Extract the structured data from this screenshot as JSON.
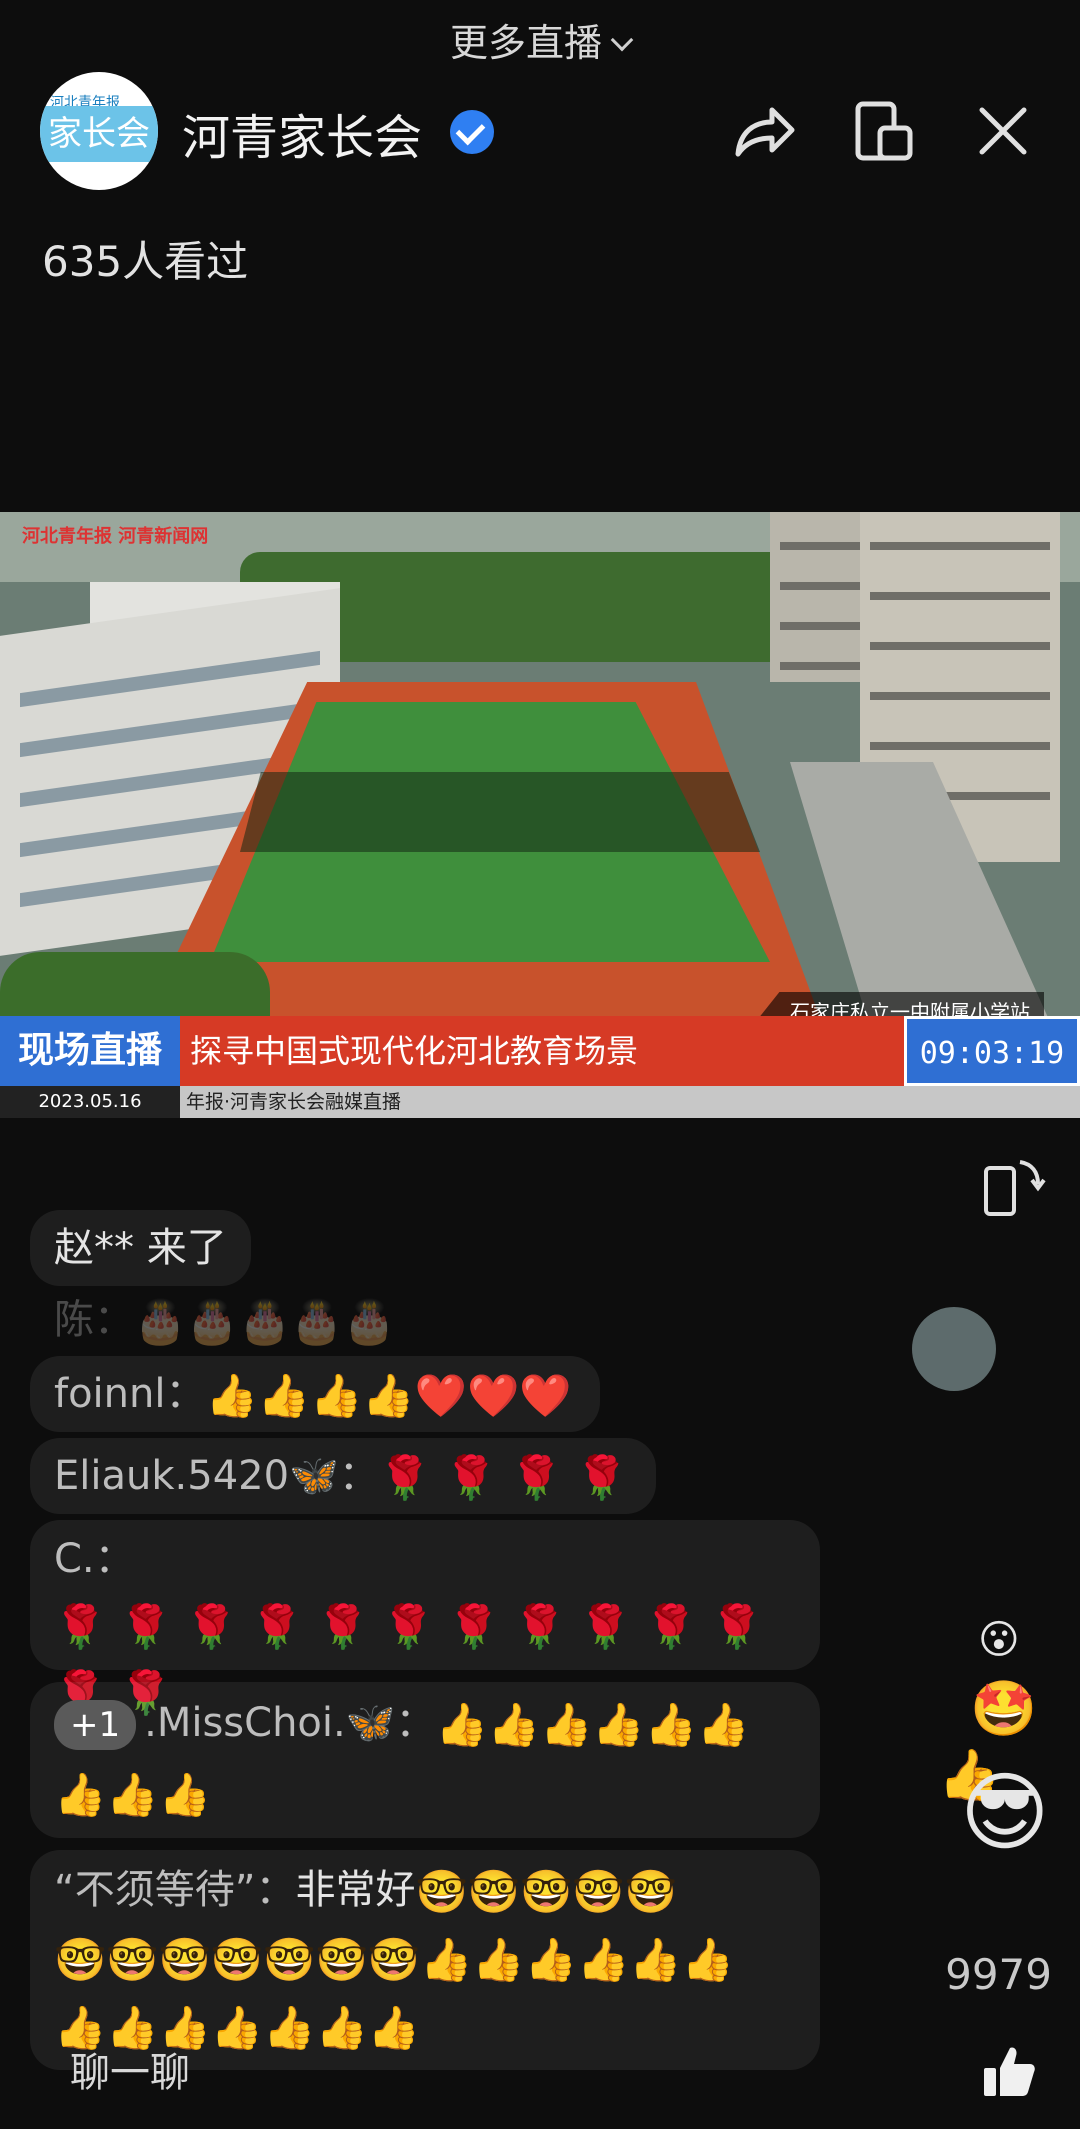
{
  "top": {
    "more_live": "更多直播"
  },
  "header": {
    "avatar_top": "河北青年报",
    "avatar_main": "家长会",
    "channel_name": "河青家长会",
    "viewers": "635人看过"
  },
  "video": {
    "watermark": "河北青年报 河青新闻网",
    "station": "石家庄私立一中附属小学站",
    "live_label": "现场直播",
    "headline": "探寻中国式现代化河北教育场景",
    "clock": "09:03:19",
    "date": "2023.05.16",
    "ticker": "年报·河青家长会融媒直播"
  },
  "comments": {
    "entered": "赵** 来了",
    "c1_name": "陈：",
    "c1_emoji": "🎂🎂🎂🎂🎂",
    "c2_name": "foinnl：",
    "c2_emoji": "👍👍👍👍❤️❤️❤️",
    "c3_name": "Eliauk.5420🦋：",
    "c3_emoji": "🌹 🌹 🌹 🌹",
    "c4_name": "C.：",
    "c4_emoji_line1": "🌹 🌹 🌹 🌹 🌹 🌹 🌹 🌹 🌹 🌹 🌹",
    "c4_emoji_line2": "🌹 🌹",
    "c5_badge": "+1",
    "c5_name": ".MissChoi.🦋：",
    "c5_emoji_line1": "👍👍👍👍👍👍",
    "c5_emoji_line2": "👍👍👍",
    "c6_name": "“不须等待”：",
    "c6_text": "非常好",
    "c6_emoji_line1": "🤓🤓🤓🤓🤓",
    "c6_emoji_line2": "🤓🤓🤓🤓🤓🤓🤓👍👍👍👍👍👍",
    "c6_emoji_line3": "👍👍👍👍👍👍👍"
  },
  "floating": [
    "😮",
    "🤩",
    "👍",
    "😎"
  ],
  "likes": "9979",
  "chat_placeholder": "聊一聊",
  "colors": {
    "live_blue": "#2f6fd3",
    "banner_red": "#d63a25",
    "verified_blue": "#2f7ff2"
  }
}
